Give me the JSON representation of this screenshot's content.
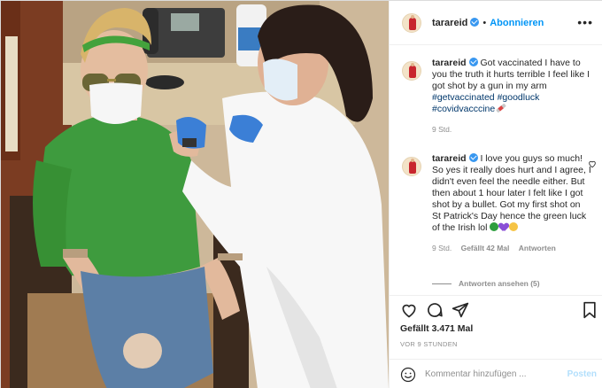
{
  "header": {
    "username": "tarareid",
    "separator": "•",
    "follow_label": "Abonnieren",
    "more_icon": "more-horizontal-icon"
  },
  "caption": {
    "username": "tarareid",
    "text": "Got vaccinated I have to you the truth it hurts terrible I feel like I got shot by a gun in my arm",
    "hashtags": [
      "#getvaccinated",
      "#goodluck",
      "#covidvacccine"
    ],
    "emoji": "syringe-emoji",
    "time": "9 Std."
  },
  "comments": [
    {
      "username": "tarareid",
      "text": "I love you guys so much! So yes it really does hurt and I agree, I didn't even feel the needle either. But then about 1 hour later I felt like I got shot by a bullet. Got my first shot on St Patrick's Day hence the green luck of the Irish lol",
      "emojis": [
        "clover-emoji",
        "purple-heart-emoji",
        "smiling-face-emoji"
      ],
      "time": "9 Std.",
      "likes": "Gefällt 42 Mal",
      "reply_label": "Antworten",
      "view_replies": "Antworten ansehen (5)"
    }
  ],
  "actions": {
    "icons": [
      "heart-icon",
      "comment-icon",
      "share-icon",
      "bookmark-icon"
    ],
    "likes_text": "Gefällt 3.471 Mal",
    "time_ago": "VOR 9 STUNDEN"
  },
  "add_comment": {
    "placeholder": "Kommentar hinzufügen ...",
    "post_label": "Posten",
    "emoji_icon": "smiley-icon"
  },
  "colors": {
    "link_blue": "#0095f6",
    "hashtag": "#00376b",
    "verified": "#3897f0",
    "meta_gray": "#8e8e8e",
    "post_disabled": "#b2dffc"
  }
}
